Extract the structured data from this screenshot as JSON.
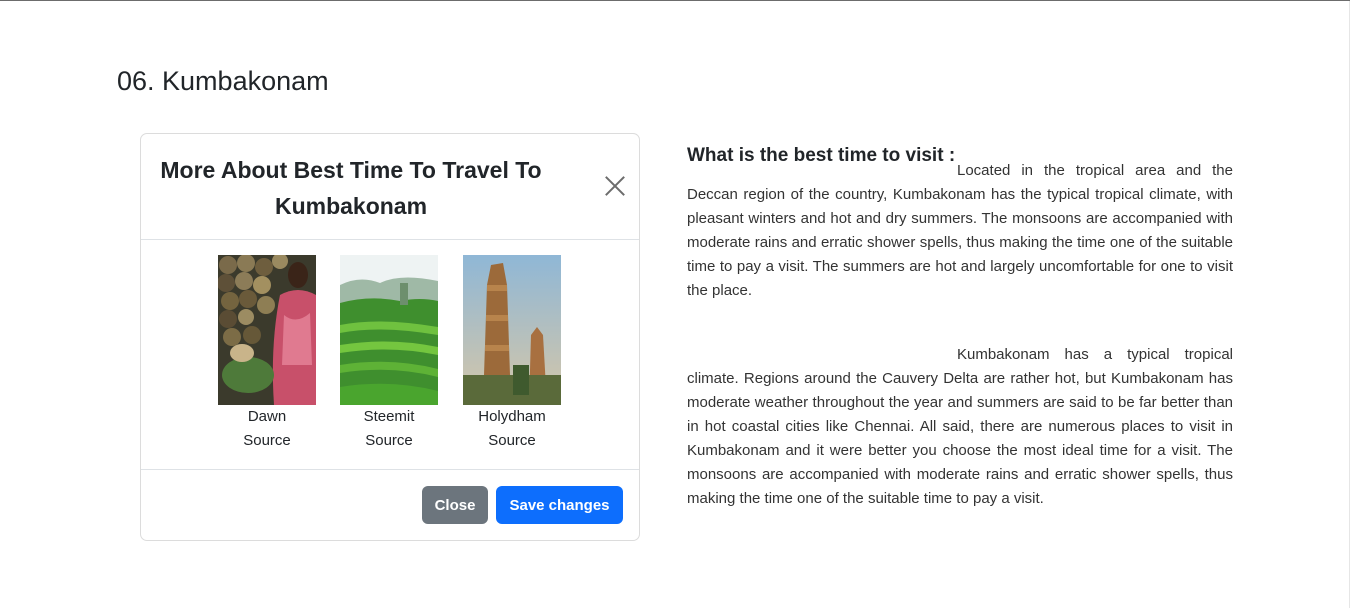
{
  "page": {
    "title": "06. Kumbakonam"
  },
  "modal": {
    "title": "More About Best Time To Travel To Kumbakonam",
    "close_icon": "close-icon",
    "gallery": [
      {
        "name": "Dawn",
        "caption": "Source",
        "image": "market-vendor-photo"
      },
      {
        "name": "Steemit",
        "caption": "Source",
        "image": "rice-field-photo"
      },
      {
        "name": "Holydham",
        "caption": "Source",
        "image": "temple-gopuram-photo"
      }
    ],
    "buttons": {
      "close_label": "Close",
      "save_label": "Save changes"
    },
    "colors": {
      "close_button": "#6c757d",
      "save_button": "#0d6efd"
    }
  },
  "info": {
    "heading": "What is the best time to visit :",
    "paragraph1": "Located in the tropical area and the Deccan region of the country, Kumbakonam has the typical tropical climate, with pleasant winters and hot and dry summers. The monsoons are accompanied with moderate rains and erratic shower spells, thus making the time one of the suitable time to pay a visit. The summers are hot and largely uncomfortable for one to visit the place.",
    "paragraph2": "Kumbakonam has a typical tropical climate. Regions around the Cauvery Delta are rather hot, but Kumbakonam has moderate weather throughout the year and summers are said to be far better than in hot coastal cities like Chennai. All said, there are numerous places to visit in Kumbakonam and it were better you choose the most ideal time for a visit. The monsoons are accompanied with moderate rains and erratic shower spells, thus making the time one of the suitable time to pay a visit."
  }
}
